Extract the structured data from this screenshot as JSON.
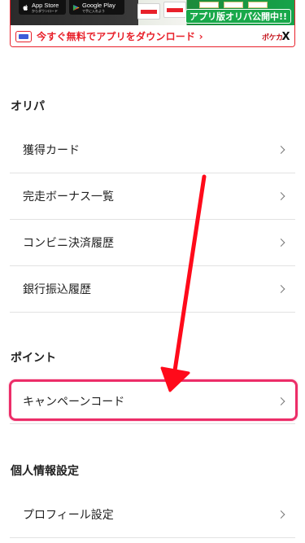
{
  "banner": {
    "app_store": {
      "title": "App Store",
      "subtitle": "からダウンロード"
    },
    "google_play": {
      "title": "Google Play",
      "subtitle": "で手に入れよう"
    },
    "headline": "アプリ版オリパ公開中!!",
    "cta": "今すぐ無料でアプリをダウンロード ›",
    "brand": "ポケカ",
    "brand_x": "X",
    "colors": {
      "accent": "#e8202a",
      "headline_bg": "#18a84a"
    }
  },
  "sections": {
    "oripa": {
      "title": "オリパ",
      "items": [
        {
          "label": "獲得カード"
        },
        {
          "label": "完走ボーナス一覧"
        },
        {
          "label": "コンビニ決済履歴"
        },
        {
          "label": "銀行振込履歴"
        }
      ]
    },
    "point": {
      "title": "ポイント",
      "items": [
        {
          "label": "キャンペーンコード"
        }
      ]
    },
    "profile": {
      "title": "個人情報設定",
      "items": [
        {
          "label": "プロフィール設定"
        }
      ]
    }
  },
  "annotation": {
    "highlight_color": "#ec2d68",
    "arrow_color": "#ff0a1a"
  },
  "icons": {
    "chevron": "chevron-right-icon",
    "app_store": "apple-icon",
    "google_play": "google-play-icon"
  }
}
